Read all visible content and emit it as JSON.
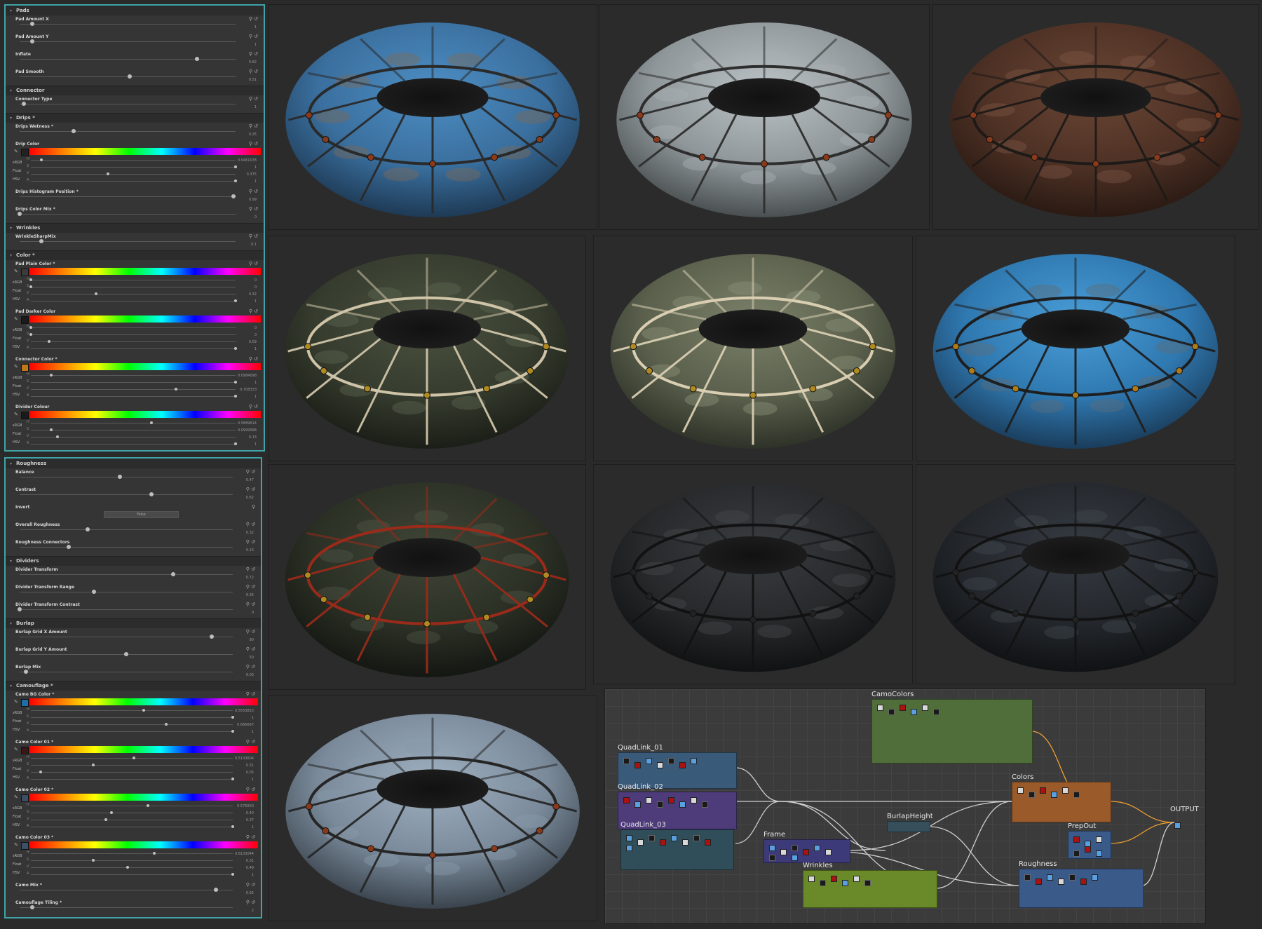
{
  "panel_top": {
    "sections": [
      {
        "title": "Pads",
        "params": [
          {
            "label": "Pad Amount X",
            "value": "1",
            "pos": 0.06
          },
          {
            "label": "Pad Amount Y",
            "value": "1",
            "pos": 0.06
          },
          {
            "label": "Inflate",
            "value": "0.82",
            "pos": 0.82
          },
          {
            "label": "Pad Smooth",
            "value": "0.51",
            "pos": 0.51
          }
        ]
      },
      {
        "title": "Connector",
        "params": [
          {
            "label": "Connector Type",
            "value": "1",
            "pos": 0.02
          }
        ]
      },
      {
        "title": "Drips *",
        "params": [
          {
            "label": "Drips Wetness *",
            "value": "0.25",
            "pos": 0.25
          }
        ]
      }
    ],
    "drip_color": {
      "label": "Drip Color",
      "rows": [
        {
          "k": "H",
          "value": "0.0461078",
          "pos": 0.05
        },
        {
          "k": "S",
          "value": "1",
          "pos": 1.0
        },
        {
          "k": "V",
          "value": "0.375",
          "pos": 0.375
        },
        {
          "k": "A",
          "value": "1",
          "pos": 1.0
        }
      ]
    },
    "drip_extra": [
      {
        "label": "Drips Histogram Position *",
        "value": "0.99",
        "pos": 0.99
      },
      {
        "label": "Drips Color Mix *",
        "value": "0",
        "pos": 0.0
      }
    ],
    "wrinkles": {
      "title": "Wrinkles",
      "label": "WrinkleSharpMix",
      "value": "0.1",
      "pos": 0.1
    },
    "color_title": "Color *",
    "colors": [
      {
        "label": "Pad Plain Color *",
        "swatch": "#3b3b3b",
        "rows": [
          {
            "k": "H",
            "value": "0",
            "pos": 0.0
          },
          {
            "k": "S",
            "value": "0",
            "pos": 0.0
          },
          {
            "k": "V",
            "value": "0.32",
            "pos": 0.32
          },
          {
            "k": "A",
            "value": "1",
            "pos": 1.0
          }
        ]
      },
      {
        "label": "Pad Darker Color",
        "swatch": "#1b1b1b",
        "rows": [
          {
            "k": "H",
            "value": "0",
            "pos": 0.0
          },
          {
            "k": "S",
            "value": "0",
            "pos": 0.0
          },
          {
            "k": "V",
            "value": "0.09",
            "pos": 0.09
          },
          {
            "k": "A",
            "value": "1",
            "pos": 1.0
          }
        ]
      },
      {
        "label": "Connector Color *",
        "swatch": "#c07818",
        "rows": [
          {
            "k": "H",
            "value": "0.0984098",
            "pos": 0.1
          },
          {
            "k": "S",
            "value": "1",
            "pos": 1.0
          },
          {
            "k": "V",
            "value": "0.708333",
            "pos": 0.71
          },
          {
            "k": "A",
            "value": "1",
            "pos": 1.0
          }
        ]
      },
      {
        "label": "Divider Colour",
        "swatch": "#1a1a1a",
        "rows": [
          {
            "k": "H",
            "value": "0.5889614",
            "pos": 0.59
          },
          {
            "k": "S",
            "value": "0.0999998",
            "pos": 0.1
          },
          {
            "k": "V",
            "value": "0.13",
            "pos": 0.13
          },
          {
            "k": "A",
            "value": "1",
            "pos": 1.0
          }
        ]
      }
    ]
  },
  "panel_bottom": {
    "sections": [
      {
        "title": "Roughness",
        "params": [
          {
            "label": "Balance",
            "value": "0.47",
            "pos": 0.47
          },
          {
            "label": "Contrast",
            "value": "0.62",
            "pos": 0.62
          }
        ]
      }
    ],
    "invert": {
      "label": "Invert",
      "button": "False"
    },
    "rough_more": [
      {
        "label": "Overall Roughness",
        "value": "0.32",
        "pos": 0.32
      },
      {
        "label": "Roughness Connectors",
        "value": "0.23",
        "pos": 0.23
      }
    ],
    "dividers": {
      "title": "Dividers",
      "params": [
        {
          "label": "Divider Transform",
          "value": "0.72",
          "pos": 0.72
        },
        {
          "label": "Divider Transform Range",
          "value": "0.35",
          "pos": 0.35
        },
        {
          "label": "Divider Transform Contrast",
          "value": "0",
          "pos": 0.0
        }
      ]
    },
    "burlap": {
      "title": "Burlap",
      "params": [
        {
          "label": "Burlap Grid X Amount",
          "value": "90",
          "pos": 0.9
        },
        {
          "label": "Burlap Grid Y Amount",
          "value": "50",
          "pos": 0.5
        },
        {
          "label": "Burlap Mix",
          "value": "0.03",
          "pos": 0.03
        }
      ]
    },
    "camo_title": "Camouflage *",
    "camo_colors": [
      {
        "label": "Camo BG Color *",
        "swatch": "#1e6ea8",
        "rows": [
          {
            "k": "H",
            "value": "0.5553823",
            "pos": 0.56
          },
          {
            "k": "S",
            "value": "1",
            "pos": 1.0
          },
          {
            "k": "V",
            "value": "0.666667",
            "pos": 0.67
          },
          {
            "k": "A",
            "value": "1",
            "pos": 1.0
          }
        ]
      },
      {
        "label": "Camo Color 01 *",
        "swatch": "#3a1818",
        "rows": [
          {
            "k": "H",
            "value": "0.5133604",
            "pos": 0.51
          },
          {
            "k": "S",
            "value": "0.31",
            "pos": 0.31
          },
          {
            "k": "V",
            "value": "0.05",
            "pos": 0.05
          },
          {
            "k": "A",
            "value": "1",
            "pos": 1.0
          }
        ]
      },
      {
        "label": "Camo Color 02 *",
        "swatch": "#3d4f66",
        "rows": [
          {
            "k": "H",
            "value": "0.575663",
            "pos": 0.58
          },
          {
            "k": "S",
            "value": "0.40",
            "pos": 0.4
          },
          {
            "k": "V",
            "value": "0.37",
            "pos": 0.37
          },
          {
            "k": "A",
            "value": "1",
            "pos": 1.0
          }
        ]
      },
      {
        "label": "Camo Color 03 *",
        "swatch": "#3d4f66",
        "rows": [
          {
            "k": "H",
            "value": "0.6133044",
            "pos": 0.61
          },
          {
            "k": "S",
            "value": "0.31",
            "pos": 0.31
          },
          {
            "k": "V",
            "value": "0.48",
            "pos": 0.48
          },
          {
            "k": "A",
            "value": "1",
            "pos": 1.0
          }
        ]
      }
    ],
    "camo_extra": [
      {
        "label": "Camo Mix *",
        "value": "0.92",
        "pos": 0.92
      },
      {
        "label": "Camouflage Tiling *",
        "value": "2",
        "pos": 0.06
      }
    ]
  },
  "renders": [
    {
      "variant": "blue-camo-rusty",
      "base": "#4d8ec4",
      "mid": "#3a6f9e",
      "dark": "#1e3a55",
      "spot": "#7a6a5a",
      "stripe": "#2a2a2a",
      "conn": "#8a3a1a"
    },
    {
      "variant": "white-plastic",
      "base": "#bcc3c6",
      "mid": "#8f9699",
      "dark": "#4a5052",
      "spot": "#a9b0b3",
      "stripe": "#2e2e2e",
      "conn": "#8a3a1a"
    },
    {
      "variant": "rusty-brown",
      "base": "#6a4634",
      "mid": "#4e3125",
      "dark": "#2a1a13",
      "spot": "#7a5543",
      "stripe": "#1e1a18",
      "conn": "#8a3a1a"
    },
    {
      "variant": "olive-camo-beige-divider",
      "base": "#4b5240",
      "mid": "#363c2e",
      "dark": "#1b1e17",
      "spot": "#5a6350",
      "stripe": "#cfc4a8",
      "conn": "#b08a20"
    },
    {
      "variant": "light-olive-beige-divider",
      "base": "#7a8068",
      "mid": "#5a604c",
      "dark": "#2e3228",
      "spot": "#8a9078",
      "stripe": "#d9ceb2",
      "conn": "#b08a20"
    },
    {
      "variant": "bright-blue-camo",
      "base": "#4a9ed8",
      "mid": "#2f78b0",
      "dark": "#1a3d5c",
      "spot": "#5a6c7a",
      "stripe": "#1e1e1e",
      "conn": "#b07a18"
    },
    {
      "variant": "dark-olive-red-divider",
      "base": "#3f4536",
      "mid": "#2c3126",
      "dark": "#141712",
      "spot": "#4e5544",
      "stripe": "#9a2a1a",
      "conn": "#b08a20"
    },
    {
      "variant": "black-rubber",
      "base": "#3a3d40",
      "mid": "#27292b",
      "dark": "#111213",
      "spot": "#444749",
      "stripe": "#121212",
      "conn": "#222"
    },
    {
      "variant": "black-rubber-blue",
      "base": "#363b42",
      "mid": "#24282d",
      "dark": "#101214",
      "spot": "#40464d",
      "stripe": "#121212",
      "conn": "#222"
    },
    {
      "variant": "pale-blue-grey",
      "base": "#9fb0c0",
      "mid": "#7a8a9a",
      "dark": "#3a444e",
      "spot": "#8898a8",
      "stripe": "#262626",
      "conn": "#8a3a1a"
    }
  ],
  "graph": {
    "frames": [
      {
        "label": "CamoColors",
        "color": "#4f6e3a"
      },
      {
        "label": "QuadLink_01",
        "color": "#3a5a7a"
      },
      {
        "label": "QuadLink_02",
        "color": "#4d3b7a"
      },
      {
        "label": "QuadLink_03",
        "color": "#2f4e5a"
      },
      {
        "label": "Colors",
        "color": "#9a5a2a"
      },
      {
        "label": "BurlapHeight",
        "color": "#35505a"
      },
      {
        "label": "PrepOut",
        "color": "#3a5a8a"
      },
      {
        "label": "Frame",
        "color": "#3d3a7a"
      },
      {
        "label": "Wrinkles",
        "color": "#6a8a2a"
      },
      {
        "label": "Roughness",
        "color": "#3a5a8a"
      }
    ],
    "output_label": "OUTPUT"
  }
}
